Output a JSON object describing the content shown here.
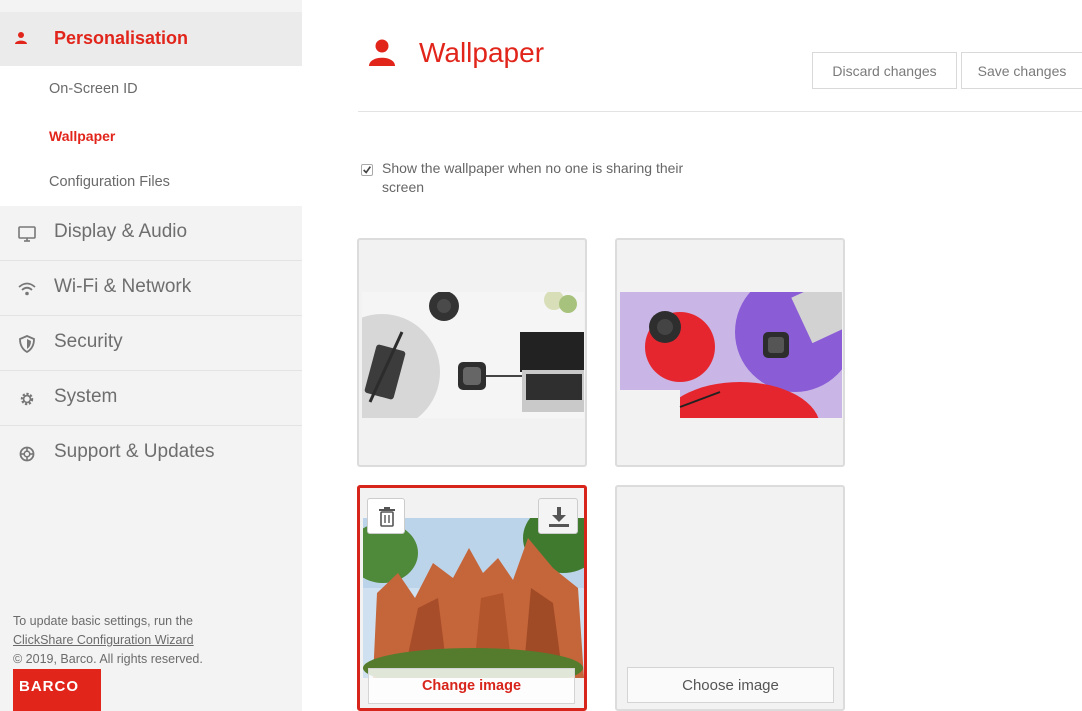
{
  "sidebar": {
    "section": {
      "label": "Personalisation",
      "icon": "user-icon"
    },
    "sub_items": [
      {
        "label": "On-Screen ID",
        "active": false
      },
      {
        "label": "Wallpaper",
        "active": true
      },
      {
        "label": "Configuration Files",
        "active": false
      }
    ],
    "items": [
      {
        "label": "Display & Audio",
        "icon": "monitor-icon"
      },
      {
        "label": "Wi-Fi & Network",
        "icon": "wifi-icon"
      },
      {
        "label": "Security",
        "icon": "shield-icon"
      },
      {
        "label": "System",
        "icon": "gear-icon"
      },
      {
        "label": "Support & Updates",
        "icon": "lifebuoy-icon"
      }
    ],
    "footer": {
      "line1": "To update basic settings, run the",
      "link": "ClickShare Configuration Wizard",
      "copyright": "© 2019, Barco. All rights reserved."
    },
    "logo": "BARCO"
  },
  "header": {
    "title": "Wallpaper",
    "icon": "user-icon",
    "discard_label": "Discard changes",
    "save_label": "Save changes"
  },
  "option": {
    "checked": true,
    "label": "Show the wallpaper when no one is sharing their screen"
  },
  "tiles": {
    "change_label": "Change image",
    "choose_label": "Choose image"
  },
  "colors": {
    "accent": "#e1251b",
    "sidebar_bg": "#f3f3f3"
  }
}
